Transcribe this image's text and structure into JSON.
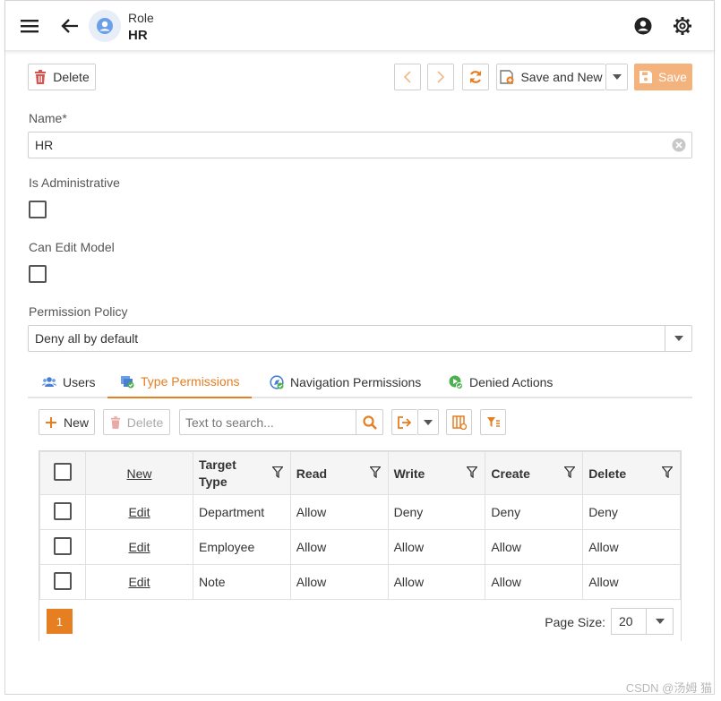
{
  "header": {
    "subtitle": "Role",
    "title": "HR"
  },
  "toolbar": {
    "delete_label": "Delete",
    "save_and_new_label": "Save and New",
    "save_label": "Save"
  },
  "form": {
    "name_label": "Name*",
    "name_value": "HR",
    "is_admin_label": "Is Administrative",
    "can_edit_model_label": "Can Edit Model",
    "permission_policy_label": "Permission Policy",
    "permission_policy_value": "Deny all by default"
  },
  "tabs": [
    {
      "label": "Users",
      "icon": "users-icon"
    },
    {
      "label": "Type Permissions",
      "icon": "type-permissions-icon",
      "active": true
    },
    {
      "label": "Navigation Permissions",
      "icon": "navigation-permissions-icon"
    },
    {
      "label": "Denied Actions",
      "icon": "denied-actions-icon"
    }
  ],
  "grid_toolbar": {
    "new_label": "New",
    "delete_label": "Delete",
    "search_placeholder": "Text to search..."
  },
  "grid": {
    "columns": [
      "New",
      "Target Type",
      "Read",
      "Write",
      "Create",
      "Delete"
    ],
    "edit_label": "Edit",
    "rows": [
      [
        "Department",
        "Allow",
        "Deny",
        "Deny",
        "Deny"
      ],
      [
        "Employee",
        "Allow",
        "Allow",
        "Allow",
        "Allow"
      ],
      [
        "Note",
        "Allow",
        "Allow",
        "Allow",
        "Allow"
      ]
    ],
    "current_page": "1",
    "page_size_label": "Page Size:",
    "page_size_value": "20"
  },
  "colors": {
    "accent": "#e67e22",
    "save_button": "#f4b37d",
    "delete_icon": "#d9534f"
  },
  "watermark": "CSDN @汤姆 猫"
}
